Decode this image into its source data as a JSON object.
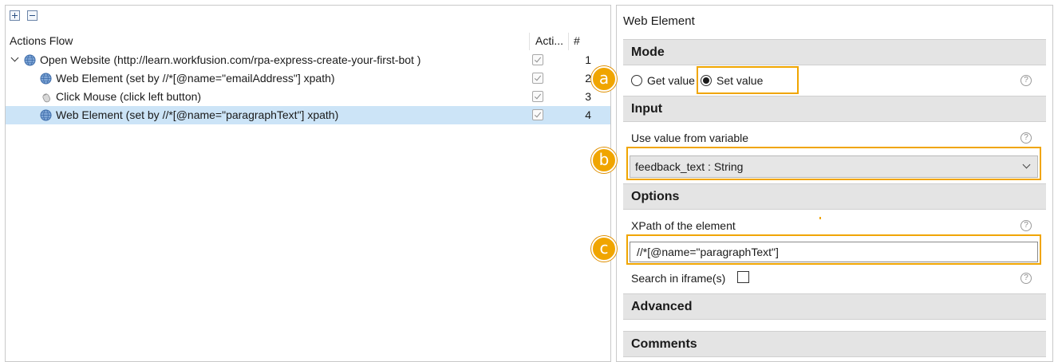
{
  "actions_flow": {
    "header": {
      "name": "Actions Flow",
      "active": "Acti...",
      "number": "#"
    },
    "rows": [
      {
        "label": "Open Website (http://learn.workfusion.com/rpa-express-create-your-first-bot )",
        "num": "1"
      },
      {
        "label": "Web Element (set by //*[@name=\"emailAddress\"] xpath)",
        "num": "2"
      },
      {
        "label": "Click Mouse (click left button)",
        "num": "3"
      },
      {
        "label": "Web Element (set by //*[@name=\"paragraphText\"] xpath)",
        "num": "4"
      }
    ]
  },
  "web_element": {
    "title": "Web Element",
    "mode": {
      "section": "Mode",
      "get_value": "Get value",
      "set_value": "Set value"
    },
    "input": {
      "section": "Input",
      "use_value_label": "Use value from variable",
      "variable_value": "feedback_text : String"
    },
    "options": {
      "section": "Options",
      "xpath_label": "XPath of the element",
      "xpath_value": "//*[@name=\"paragraphText\"]",
      "iframe_label": "Search in iframe(s)"
    },
    "advanced": {
      "section": "Advanced"
    },
    "comments": {
      "section": "Comments"
    },
    "help_glyph": "?"
  },
  "callouts": {
    "a": "a",
    "b": "b",
    "c": "c"
  },
  "colors": {
    "accent": "#f0a500",
    "selection": "#cce4f7"
  }
}
